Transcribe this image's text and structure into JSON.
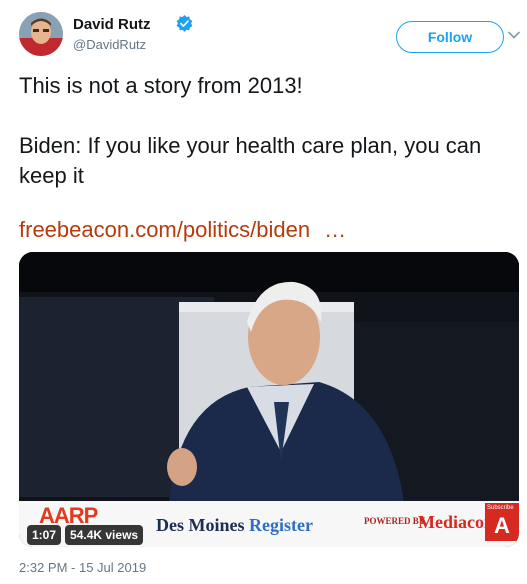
{
  "author": {
    "name": "David Rutz",
    "handle": "@DavidRutz",
    "verified": true,
    "avatar_icon": "avatar-photo"
  },
  "actions": {
    "follow_label": "Follow",
    "more_icon": "chevron-down-icon"
  },
  "tweet": {
    "line1": "This is not a story from 2013!",
    "line2": "Biden: If you like your health care plan, you can keep it",
    "link_text": "freebeacon.com/politics/biden",
    "link_ellipsis": "…",
    "timestamp": "2:32 PM - 15 Jul 2019"
  },
  "video": {
    "duration": "1:07",
    "views": "54.4K views",
    "lower_third": {
      "aarp": "AARP",
      "dmr_part1": "Des Moines ",
      "dmr_part2": "Register",
      "powered_by": "POWERED BY",
      "mediacom": "Mediacom",
      "subscribe": "Subscribe",
      "subscribe_letter": "A"
    }
  },
  "colors": {
    "twitter_blue": "#1da1f2",
    "link": "#b73a0d",
    "secondary_text": "#657786"
  }
}
